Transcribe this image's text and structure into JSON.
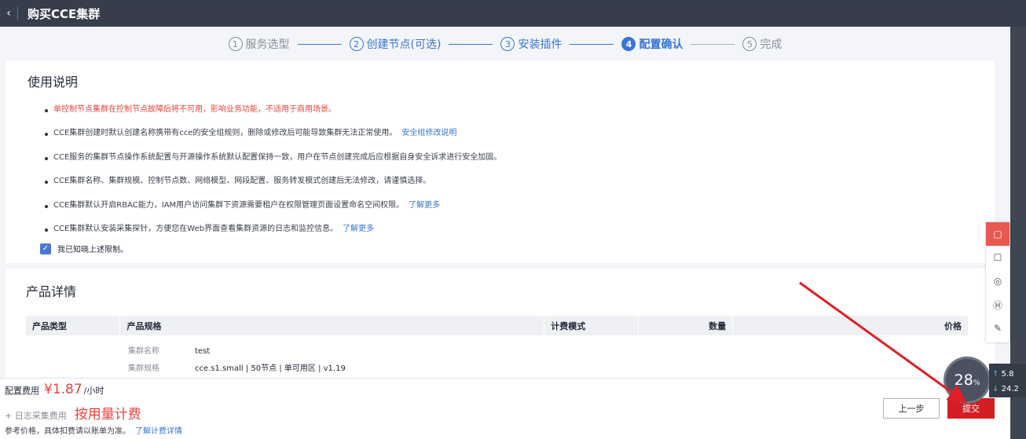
{
  "header": {
    "back_icon": "chevron-left-icon",
    "title": "购买CCE集群"
  },
  "steps": [
    {
      "num": "1",
      "label": "服务选型",
      "state": "done"
    },
    {
      "num": "2",
      "label": "创建节点(可选)",
      "state": "done"
    },
    {
      "num": "3",
      "label": "安装插件",
      "state": "done"
    },
    {
      "num": "4",
      "label": "配置确认",
      "state": "active"
    },
    {
      "num": "5",
      "label": "完成",
      "state": "todo"
    }
  ],
  "usage": {
    "title": "使用说明",
    "notes": [
      {
        "text": "单控制节点集群在控制节点故障后将不可用，影响业务功能，不适用于商用场景。",
        "link": ""
      },
      {
        "text": "CCE集群创建时默认创建名称携带有cce的安全组规则，删除或修改后可能导致集群无法正常使用。",
        "link": "安全组修改说明"
      },
      {
        "text": "CCE服务的集群节点操作系统配置与开源操作系统默认配置保持一致，用户在节点创建完成后应根据自身安全诉求进行安全加固。",
        "link": ""
      },
      {
        "text": "CCE集群名称、集群规模、控制节点数、网络模型、网段配置、服务转发模式创建后无法修改，请谨慎选择。",
        "link": ""
      },
      {
        "text": "CCE集群默认开启RBAC能力，IAM用户访问集群下资源需要租户在权限管理页面设置命名空间权限。",
        "link": "了解更多"
      },
      {
        "text": "CCE集群默认安装采集探针，方便您在Web界面查看集群资源的日志和监控信息。",
        "link": "了解更多"
      }
    ],
    "agree_label": "我已知晓上述限制。"
  },
  "product": {
    "title": "产品详情",
    "columns": [
      "产品类型",
      "产品规格",
      "计费模式",
      "数量",
      "价格"
    ],
    "specs": [
      {
        "label": "集群名称",
        "value": "test"
      },
      {
        "label": "集群规格",
        "value": "cce.s1.small | 50节点 | 单可用区 | v1.19"
      }
    ]
  },
  "footer": {
    "config_fee_label": "配置费用",
    "config_fee_price": "¥1.87",
    "config_fee_unit": "/小时",
    "log_fee_label": "+ 日志采集费用",
    "log_fee_value": "按用量计费",
    "ref_text": "参考价格，具体扣费请以账单为准。",
    "ref_link": "了解计费详情",
    "prev_button": "上一步",
    "submit_button": "提交"
  },
  "side_tools": [
    "chat-icon",
    "survey-icon",
    "headset-icon",
    "help-icon",
    "feedback-icon"
  ],
  "monitor": {
    "percent": "28",
    "percent_unit": "%",
    "upload": "5.8",
    "download": "24.2"
  },
  "colors": {
    "accent": "#3a74d6",
    "danger": "#e8433c",
    "submit": "#d31e24",
    "topbar": "#363e4b"
  }
}
